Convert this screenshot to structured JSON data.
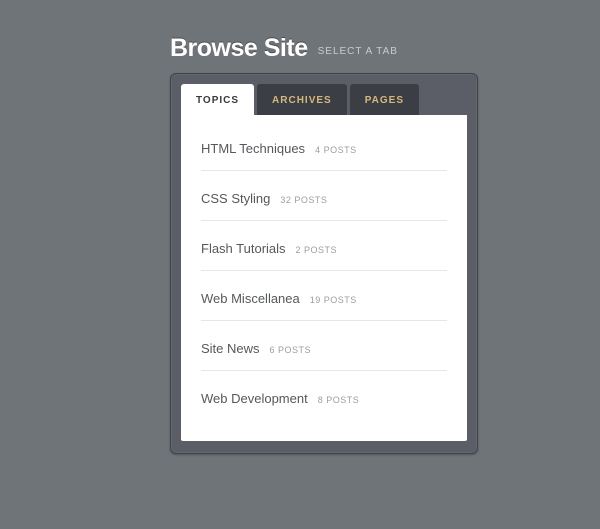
{
  "header": {
    "title": "Browse Site",
    "subtitle": "SELECT A TAB"
  },
  "tabs": [
    {
      "label": "TOPICS",
      "active": true
    },
    {
      "label": "ARCHIVES",
      "active": false
    },
    {
      "label": "PAGES",
      "active": false
    }
  ],
  "topics": [
    {
      "label": "HTML Techniques",
      "meta": "4 POSTS"
    },
    {
      "label": "CSS Styling",
      "meta": "32 POSTS"
    },
    {
      "label": "Flash Tutorials",
      "meta": "2 POSTS"
    },
    {
      "label": "Web Miscellanea",
      "meta": "19 POSTS"
    },
    {
      "label": "Site News",
      "meta": "6 POSTS"
    },
    {
      "label": "Web Development",
      "meta": "8 POSTS"
    }
  ]
}
